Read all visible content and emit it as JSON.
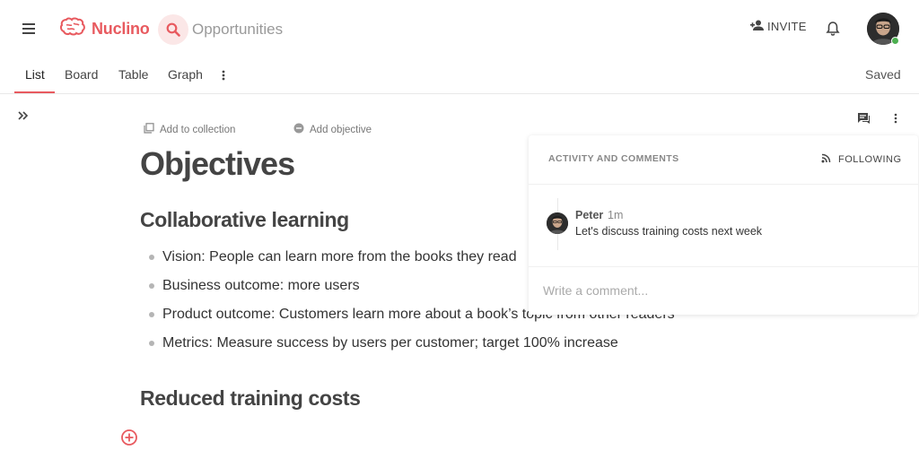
{
  "app": {
    "name": "Nuclino",
    "accent": "#e85a5f",
    "search_text": "Opportunities"
  },
  "header": {
    "invite_label": "INVITE"
  },
  "tabs": [
    {
      "label": "List",
      "active": true
    },
    {
      "label": "Board",
      "active": false
    },
    {
      "label": "Table",
      "active": false
    },
    {
      "label": "Graph",
      "active": false
    }
  ],
  "status": {
    "saved": "Saved"
  },
  "document": {
    "add_to_collection": "Add to collection",
    "add_objective": "Add objective",
    "title": "Objectives",
    "sections": [
      {
        "heading": "Collaborative learning",
        "bullets": [
          "Vision: People can learn more from the books they read",
          "Business outcome: more users",
          "Product outcome: Customers learn more about a book’s topic from other readers",
          "Metrics: Measure success by users per customer; target 100% increase"
        ]
      },
      {
        "heading": "Reduced training costs",
        "bullets": []
      }
    ]
  },
  "comments_panel": {
    "heading": "ACTIVITY AND COMMENTS",
    "following_label": "FOLLOWING",
    "comments": [
      {
        "author": "Peter",
        "time": "1m",
        "text": "Let's discuss training costs next week"
      }
    ],
    "input_placeholder": "Write a comment..."
  },
  "icons": {
    "menu": "hamburger-icon",
    "logo": "brain-icon",
    "search": "search-icon",
    "invite": "person-add-icon",
    "notifications": "bell-icon",
    "tab_more": "vertical-dots-icon",
    "expand": "double-chevron-right-icon",
    "collection": "copy-icon",
    "objective": "circle-minus-icon",
    "comments": "chat-icon",
    "doc_more": "vertical-dots-icon",
    "rss": "rss-icon",
    "add_block": "plus-circle-icon"
  }
}
